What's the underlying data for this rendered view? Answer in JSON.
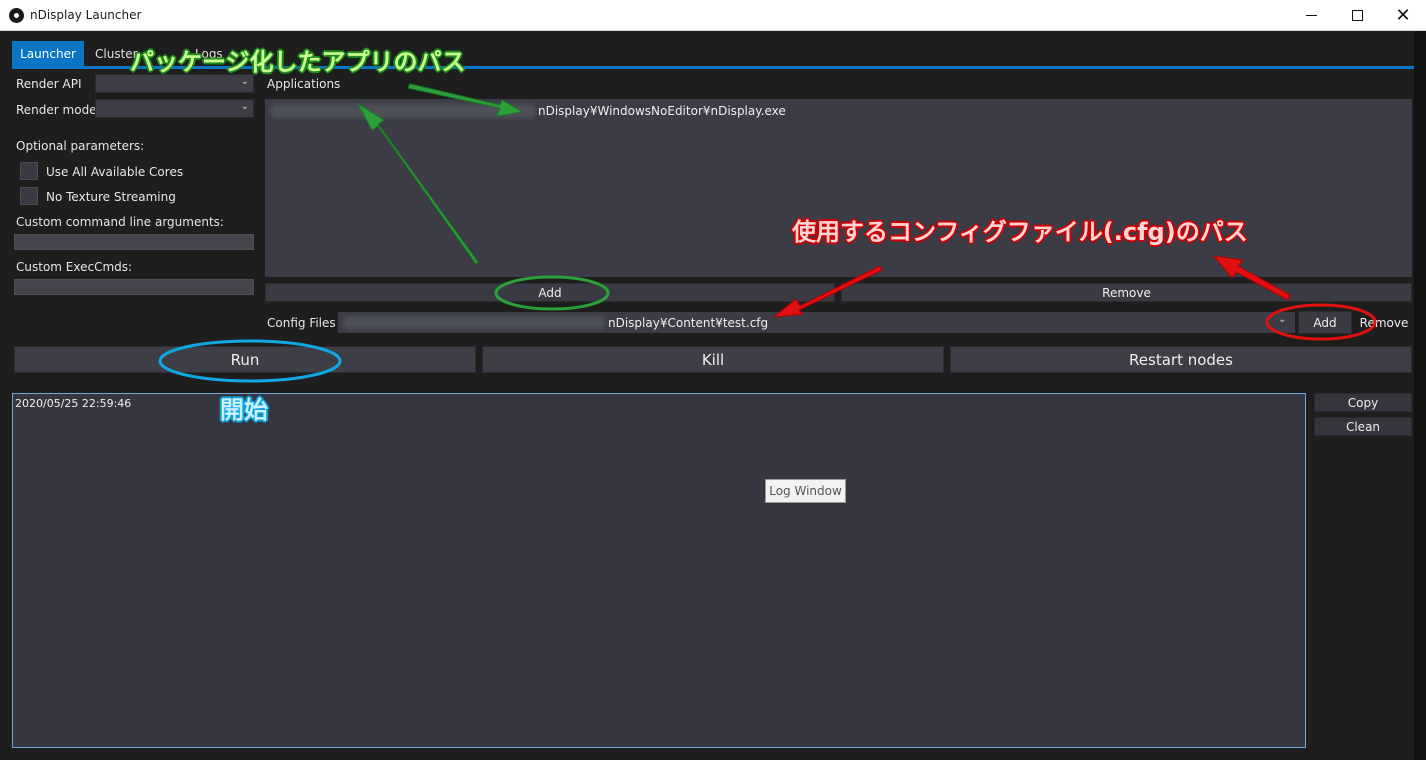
{
  "window": {
    "title": "nDisplay Launcher",
    "controls": {
      "minimize": "—",
      "maximize": "□",
      "close": "✕"
    }
  },
  "tabs": [
    {
      "label": "Launcher",
      "active": true
    },
    {
      "label": "Cluster",
      "active": false
    },
    {
      "label": "Logs",
      "active": false
    }
  ],
  "left_panel": {
    "render_api_label": "Render API",
    "render_mode_label": "Render mode",
    "optional_params_label": "Optional parameters:",
    "use_all_cores_label": "Use All Available Cores",
    "no_texture_streaming_label": "No Texture Streaming",
    "custom_cmd_label": "Custom command line arguments:",
    "custom_execcmds_label": "Custom ExecCmds:"
  },
  "applications": {
    "label": "Applications",
    "path_suffix": "nDisplay¥WindowsNoEditor¥nDisplay.exe",
    "add_label": "Add",
    "remove_label": "Remove"
  },
  "config": {
    "label": "Config Files",
    "path_suffix": "nDisplay¥Content¥test.cfg",
    "add_label": "Add",
    "remove_label": "Remove"
  },
  "actions": {
    "run_label": "Run",
    "kill_label": "Kill",
    "restart_label": "Restart nodes"
  },
  "log": {
    "timestamp": "2020/05/25 22:59:46",
    "tooltip": "Log Window",
    "copy_label": "Copy",
    "clean_label": "Clean"
  },
  "annotations": {
    "app_path_note": "パッケージ化したアプリのパス",
    "config_path_note": "使用するコンフィグファイル(.cfg)のパス",
    "run_note": "開始",
    "colors": {
      "green": "#1e8a1e",
      "red": "#d20000",
      "blue": "#0b9fdc"
    }
  }
}
